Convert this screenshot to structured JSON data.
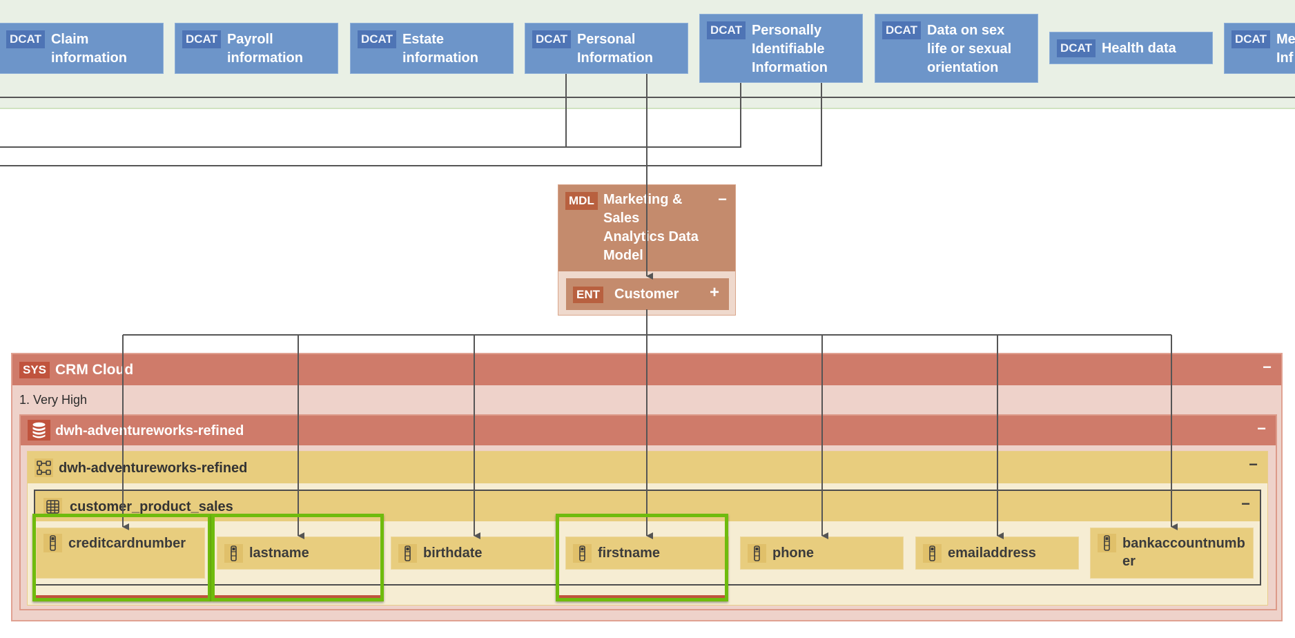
{
  "dcat_band": {
    "items": [
      {
        "tag": "DCAT",
        "label": "Claim\ninformation"
      },
      {
        "tag": "DCAT",
        "label": "Payroll\ninformation"
      },
      {
        "tag": "DCAT",
        "label": "Estate\ninformation"
      },
      {
        "tag": "DCAT",
        "label": "Personal\nInformation"
      },
      {
        "tag": "DCAT",
        "label": "Personally\nIdentifiable\nInformation"
      },
      {
        "tag": "DCAT",
        "label": "Data on sex\nlife or sexual\norientation"
      },
      {
        "tag": "DCAT",
        "label": "Health data"
      },
      {
        "tag": "DCAT",
        "label": "Me\nInf"
      }
    ]
  },
  "model": {
    "tag": "MDL",
    "title": "Marketing &\nSales\nAnalytics Data\nModel",
    "collapse_icon": "−",
    "entity": {
      "tag": "ENT",
      "title": "Customer",
      "expand_icon": "+"
    }
  },
  "system": {
    "tag": "SYS",
    "title": "CRM Cloud",
    "criticality": "1. Very High",
    "collapse_icon": "−",
    "database": {
      "icon": "database-icon",
      "title": "dwh-adventureworks-refined",
      "collapse_icon": "−",
      "schema": {
        "icon": "schema-icon",
        "title": "dwh-adventureworks-refined",
        "collapse_icon": "−",
        "table": {
          "icon": "table-icon",
          "title": "customer_product_sales",
          "collapse_icon": "−",
          "columns": [
            {
              "name": "creditcardnumber",
              "highlighted": true
            },
            {
              "name": "lastname",
              "highlighted": true
            },
            {
              "name": "birthdate",
              "highlighted": false
            },
            {
              "name": "firstname",
              "highlighted": true
            },
            {
              "name": "phone",
              "highlighted": false
            },
            {
              "name": "emailaddress",
              "highlighted": false
            },
            {
              "name": "bankaccountnumber",
              "highlighted": false
            }
          ]
        }
      }
    }
  },
  "colors": {
    "dcat": "#6d95c9",
    "model": "#c48b6d",
    "system": "#cf7b6a",
    "schema": "#e8cd7e",
    "highlight": "#6fbb0d",
    "wire": "#555555"
  }
}
